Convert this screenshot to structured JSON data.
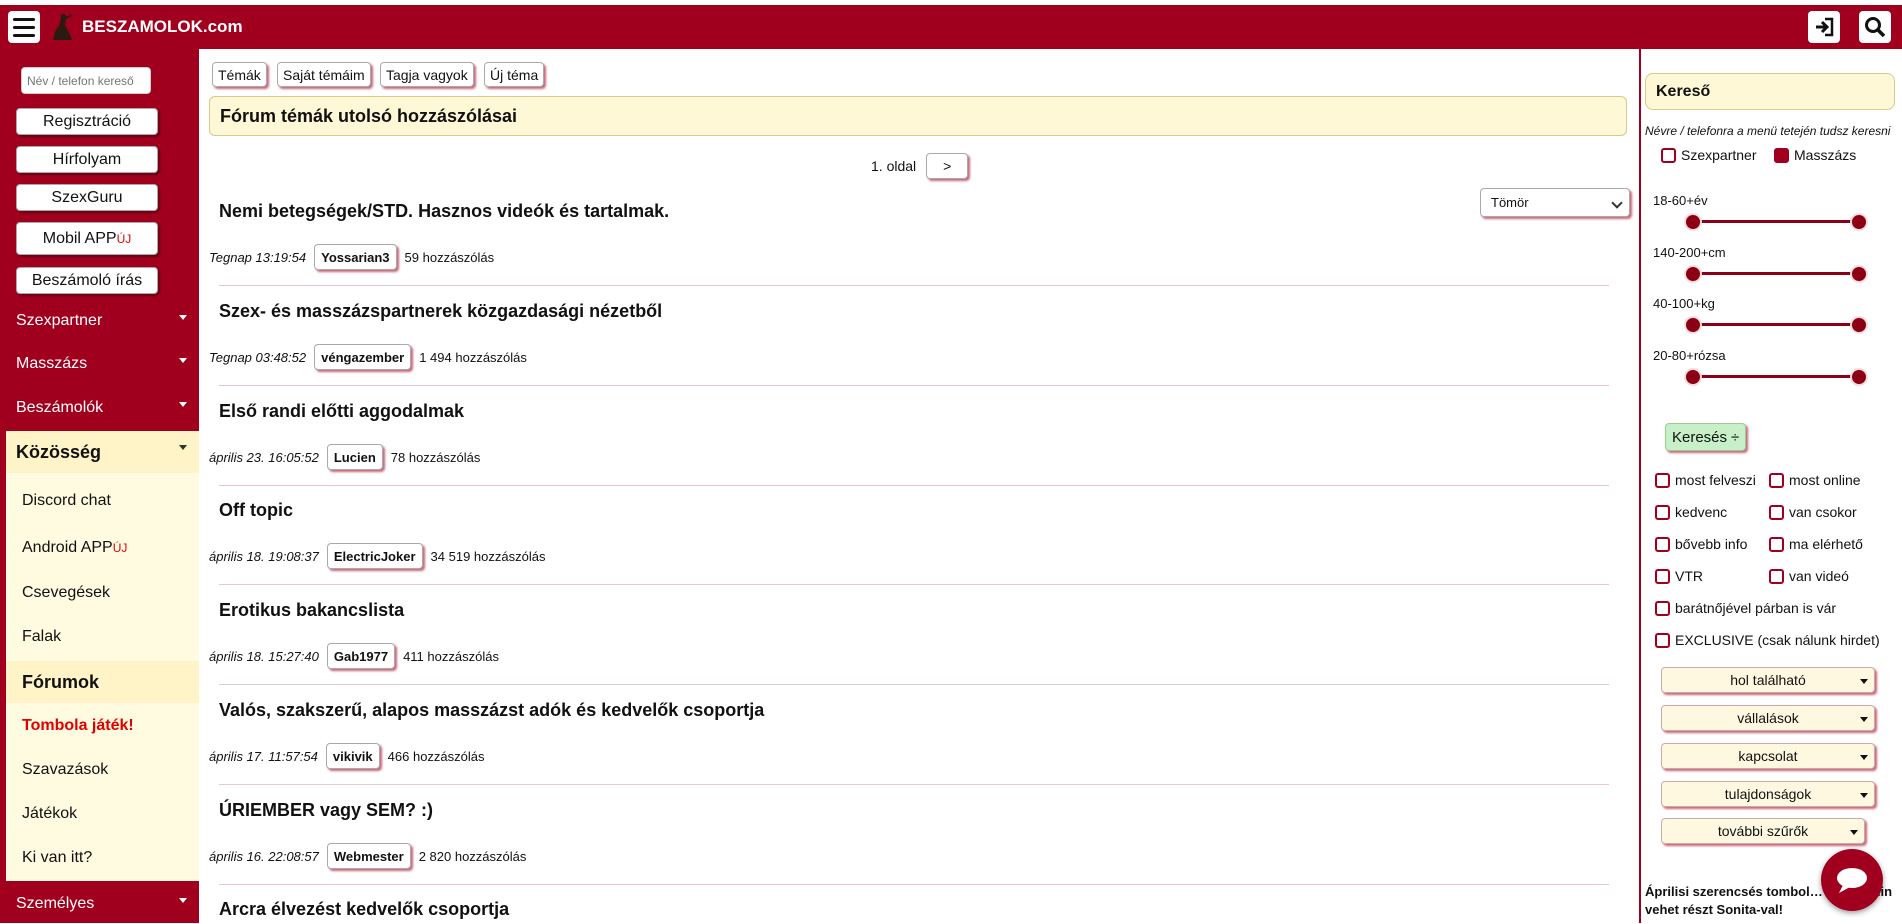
{
  "header": {
    "logo_text": "BESZAMOLOK.com"
  },
  "sidebar": {
    "search_placeholder": "Név / telefon kereső",
    "buttons": [
      "Regisztráció",
      "Hírfolyam",
      "SzexGuru",
      "Mobil APP",
      "Beszámoló írás"
    ],
    "new_badge": "ÚJ",
    "categories": [
      "Szexpartner",
      "Masszázs",
      "Beszámolók"
    ],
    "community": {
      "title": "Közösség",
      "items": [
        "Discord chat",
        "Android APP",
        "Csevegések",
        "Falak",
        "Fórumok",
        "Tombola játék!",
        "Szavazások",
        "Játékok",
        "Ki van itt?"
      ]
    },
    "personal": "Személyes"
  },
  "main": {
    "tabs": [
      "Témák",
      "Saját témáim",
      "Tagja vagyok",
      "Új téma"
    ],
    "title": "Fórum témák utolsó hozzászólásai",
    "page_label": "1. oldal",
    "next_label": ">",
    "view_select": "Tömör",
    "topics": [
      {
        "title": "Nemi betegségek/STD. Hasznos videók és tartalmak.",
        "date": "Tegnap 13:19:54",
        "user": "Yossarian3",
        "count": "59 hozzászólás"
      },
      {
        "title": "Szex- és masszázspartnerek közgazdasági nézetből",
        "date": "Tegnap 03:48:52",
        "user": "véngazember",
        "count": "1 494 hozzászólás"
      },
      {
        "title": "Első randi előtti aggodalmak",
        "date": "április 23. 16:05:52",
        "user": "Lucien",
        "count": "78 hozzászólás"
      },
      {
        "title": "Off topic",
        "date": "április 18. 19:08:37",
        "user": "ElectricJoker",
        "count": "34 519 hozzászólás"
      },
      {
        "title": "Erotikus bakancslista",
        "date": "április 18. 15:27:40",
        "user": "Gab1977",
        "count": "411 hozzászólás"
      },
      {
        "title": "Valós, szakszerű, alapos masszázst adók és kedvelők csoportja",
        "date": "április 17. 11:57:54",
        "user": "vikivik",
        "count": "466 hozzászólás"
      },
      {
        "title": "ÚRIEMBER vagy SEM? :)",
        "date": "április 16. 22:08:57",
        "user": "Webmester",
        "count": "2 820 hozzászólás"
      },
      {
        "title": "Arcra élvezést kedvelők csoportja",
        "date": "",
        "user": "",
        "count": ""
      }
    ]
  },
  "right": {
    "title": "Kereső",
    "hint": "Névre / telefonra a menü tetején tudsz keresni",
    "type_checks": [
      {
        "label": "Szexpartner",
        "checked": false
      },
      {
        "label": "Masszázs",
        "checked": true
      }
    ],
    "ranges": [
      "18-60+év",
      "140-200+cm",
      "40-100+kg",
      "20-80+rózsa"
    ],
    "search_button": "Keresés",
    "filters": [
      "most felveszi",
      "most online",
      "kedvenc",
      "van csokor",
      "bővebb info",
      "ma elérhető",
      "VTR",
      "van videó"
    ],
    "filter_wide": [
      "barátnőjével párban is vár",
      "EXCLUSIVE (csak nálunk hirdet)"
    ],
    "dropdowns": [
      "hol található",
      "vállalások",
      "kapcsolat",
      "tulajdonságok",
      "további szűrők"
    ],
    "promo": "Áprilisi szerencsés tombol… egy randin vehet részt Sonita-val!"
  },
  "colors": {
    "brand": "#a0001e",
    "highlight": "#fff8d6"
  }
}
